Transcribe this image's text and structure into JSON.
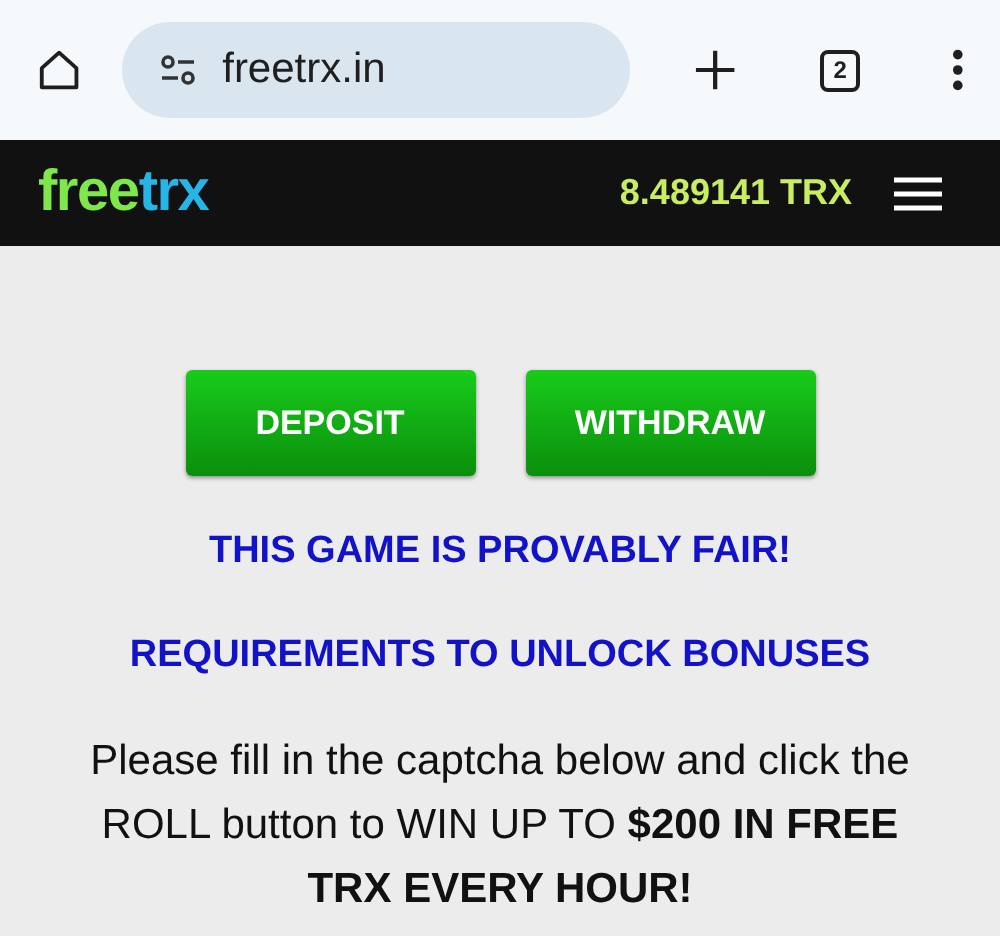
{
  "browser": {
    "url": "freetrx.in",
    "tab_count": "2"
  },
  "header": {
    "logo": [
      {
        "text": "free",
        "color": "#7ee84a"
      },
      {
        "text": "trx",
        "color": "#27b4e6"
      }
    ],
    "balance": "8.489141 TRX"
  },
  "buttons": [
    "DEPOSIT",
    "WITHDRAW"
  ],
  "links": [
    "THIS GAME IS PROVABLY FAIR!",
    "REQUIREMENTS TO UNLOCK BONUSES"
  ],
  "message": "Please fill in the captcha below and click the ROLL button to WIN UP TO **$200 IN FREE TRX EVERY HOUR!**"
}
